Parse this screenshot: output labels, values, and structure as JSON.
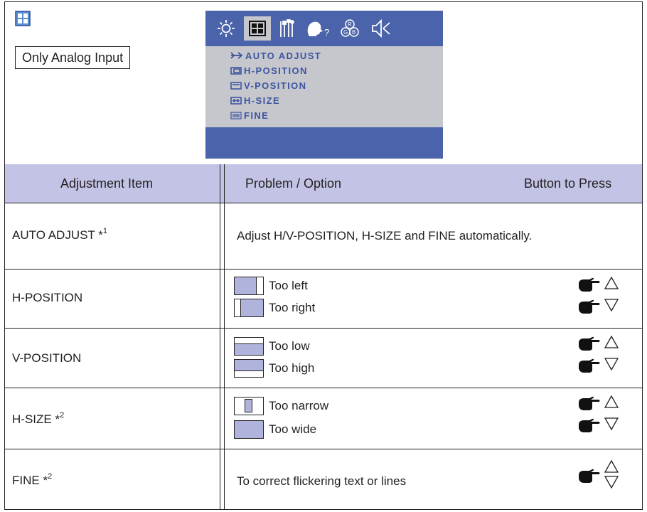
{
  "header": {
    "mode_icon": "grid-window-icon",
    "input_note": "Only Analog Input"
  },
  "osd": {
    "tabs": [
      "brightness-icon",
      "geometry-icon",
      "tools-icon",
      "info-icon",
      "color-icon",
      "audio-icon"
    ],
    "selected_tab": 1,
    "items": [
      "AUTO ADJUST",
      "H-POSITION",
      "V-POSITION",
      "H-SIZE",
      "FINE"
    ],
    "colors": {
      "panel": "#4a63aa",
      "menu_bg": "#c6c7cd",
      "text": "#3c55a0"
    }
  },
  "table": {
    "col_item": "Adjustment Item",
    "col_problem": "Problem / Option",
    "col_button": "Button to Press",
    "header_bg": "#c3c3e6",
    "rows": [
      {
        "item": "AUTO ADJUST *",
        "note": "1",
        "desc": "Adjust H/V-POSITION, H-SIZE and FINE automatically."
      },
      {
        "item": "H-POSITION",
        "opt1": "Too left",
        "opt2": "Too right"
      },
      {
        "item": "V-POSITION",
        "opt1": "Too low",
        "opt2": "Too high"
      },
      {
        "item": "H-SIZE *",
        "note": "2",
        "opt1": "Too narrow",
        "opt2": "Too wide"
      },
      {
        "item": "FINE *",
        "note": "2",
        "desc": "To correct flickering text or lines"
      }
    ]
  },
  "buttons": {
    "pointer_icon": "pointing-hand-icon",
    "up_icon": "up-triangle-icon",
    "down_icon": "down-triangle-icon"
  }
}
